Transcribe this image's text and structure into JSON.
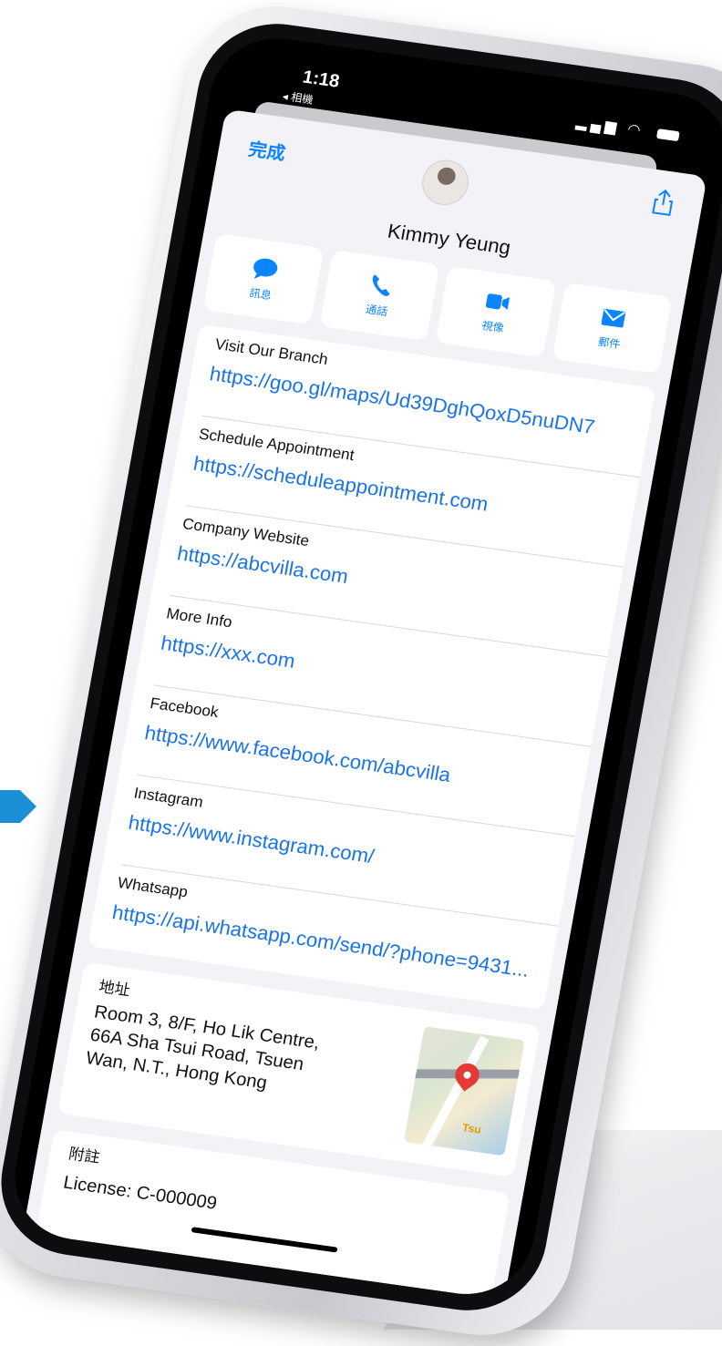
{
  "status": {
    "time": "1:18",
    "back_label": "◂ 相機"
  },
  "header": {
    "done_label": "完成",
    "contact_name": "Kimmy Yeung"
  },
  "actions": [
    {
      "label": "訊息",
      "icon": "message-icon"
    },
    {
      "label": "通話",
      "icon": "phone-icon"
    },
    {
      "label": "視像",
      "icon": "video-icon"
    },
    {
      "label": "郵件",
      "icon": "mail-icon"
    }
  ],
  "links": [
    {
      "label": "Visit Our Branch",
      "value": "https://goo.gl/maps/Ud39DghQoxD5nuDN7"
    },
    {
      "label": "Schedule Appointment",
      "value": "https://scheduleappointment.com"
    },
    {
      "label": "Company Website",
      "value": "https://abcvilla.com"
    },
    {
      "label": "More Info",
      "value": "https://xxx.com"
    },
    {
      "label": "Facebook",
      "value": "https://www.facebook.com/abcvilla"
    },
    {
      "label": "Instagram",
      "value": "https://www.instagram.com/"
    },
    {
      "label": "Whatsapp",
      "value": "https://api.whatsapp.com/send/?phone=9431..."
    }
  ],
  "address": {
    "label": "地址",
    "value": "Room 3, 8/F, Ho Lik Centre, 66A Sha Tsui Road, Tsuen Wan, N.T., Hong Kong",
    "map_tag": "Tsu"
  },
  "notes": {
    "label": "附註",
    "value": "License: C-000009"
  },
  "colors": {
    "accent": "#0a84ff",
    "link": "#1a73e8",
    "pin": "#e53935"
  }
}
